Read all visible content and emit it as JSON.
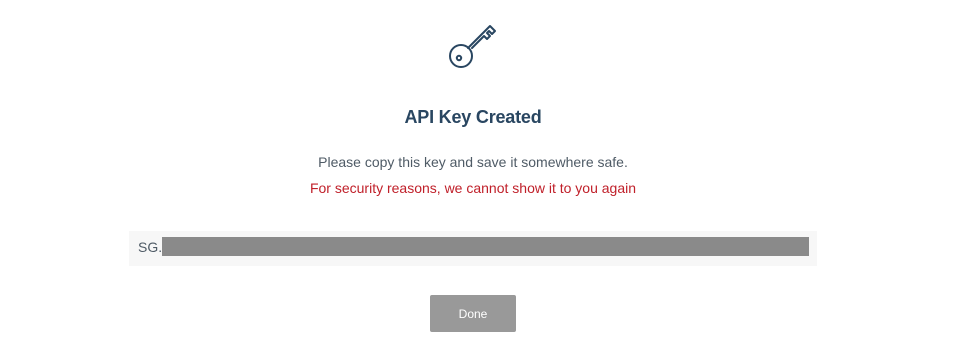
{
  "modal": {
    "icon": "key-icon",
    "title": "API Key Created",
    "message": "Please copy this key and save it somewhere safe.",
    "warning": "For security reasons, we cannot show it to you again",
    "api_key_prefix": "SG.",
    "done_label": "Done"
  },
  "colors": {
    "title": "#294661",
    "warning": "#c0202a",
    "button": "#999999",
    "redaction": "#8a8a8a"
  }
}
